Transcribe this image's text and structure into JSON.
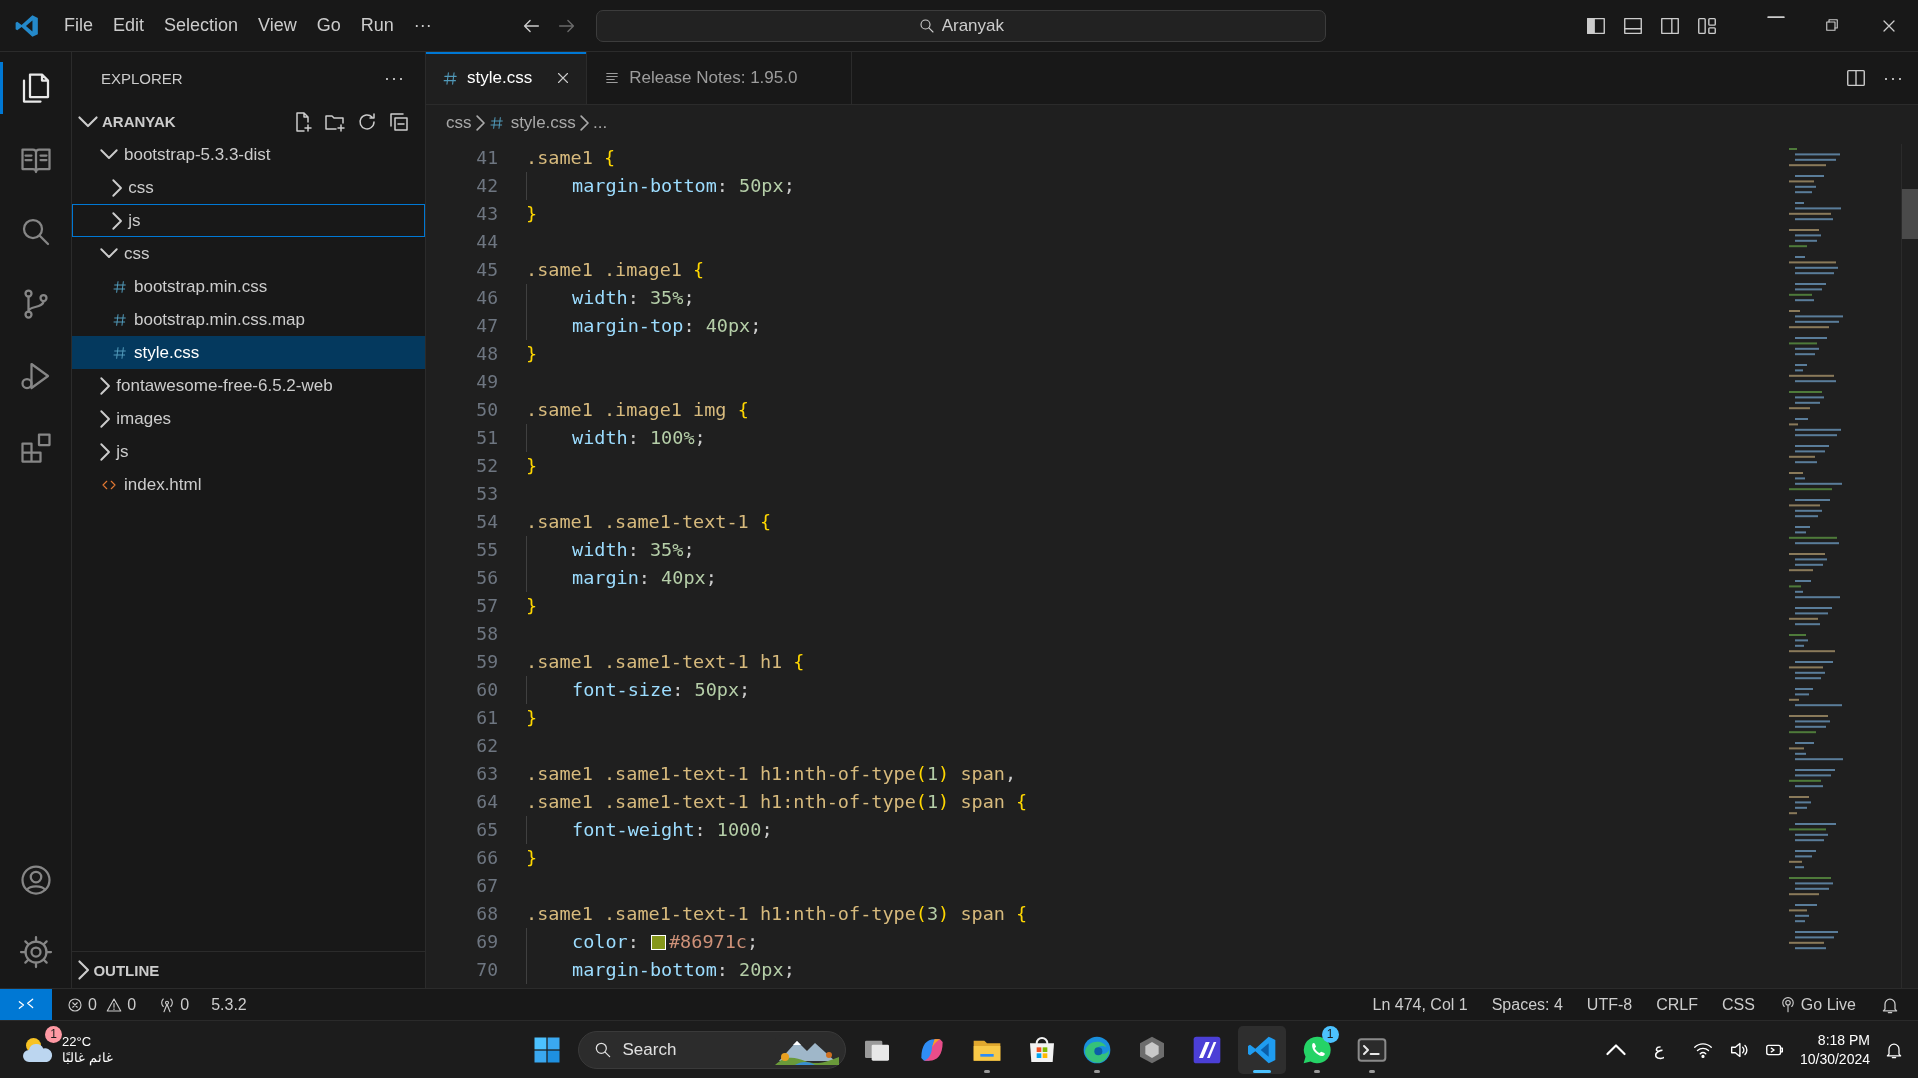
{
  "title_bar": {
    "menus": [
      "File",
      "Edit",
      "Selection",
      "View",
      "Go",
      "Run",
      "···"
    ],
    "command_center": "Aranyak"
  },
  "activity_bar": {
    "top": [
      {
        "kind": "files",
        "selected": true
      },
      {
        "kind": "book",
        "selected": false
      },
      {
        "kind": "search",
        "selected": false
      },
      {
        "kind": "branch",
        "selected": false
      },
      {
        "kind": "run",
        "selected": false
      },
      {
        "kind": "extensions",
        "selected": false
      }
    ],
    "bottom": [
      {
        "kind": "account",
        "selected": false
      },
      {
        "kind": "gear",
        "selected": false
      }
    ]
  },
  "sidebar": {
    "title": "EXPLORER",
    "more": "···",
    "root": {
      "label": "ARANYAK",
      "expanded": true
    },
    "tree": [
      {
        "label": "bootstrap-5.3.3-dist",
        "kind": "folder",
        "expanded": true,
        "selected": false,
        "focused": false,
        "children": [
          {
            "label": "css",
            "kind": "folder",
            "expanded": false,
            "selected": false,
            "focused": false
          },
          {
            "label": "js",
            "kind": "folder",
            "expanded": false,
            "selected": false,
            "focused": true
          }
        ]
      },
      {
        "label": "css",
        "kind": "folder",
        "expanded": true,
        "selected": false,
        "focused": false,
        "children": [
          {
            "label": "bootstrap.min.css",
            "kind": "css",
            "selected": false,
            "focused": false
          },
          {
            "label": "bootstrap.min.css.map",
            "kind": "css",
            "selected": false,
            "focused": false
          },
          {
            "label": "style.css",
            "kind": "css",
            "selected": true,
            "focused": false
          }
        ]
      },
      {
        "label": "fontawesome-free-6.5.2-web",
        "kind": "folder",
        "expanded": false,
        "selected": false,
        "focused": false
      },
      {
        "label": "images",
        "kind": "folder",
        "expanded": false,
        "selected": false,
        "focused": false
      },
      {
        "label": "js",
        "kind": "folder",
        "expanded": false,
        "selected": false,
        "focused": false
      },
      {
        "label": "index.html",
        "kind": "html",
        "selected": false,
        "focused": false
      }
    ],
    "outline": {
      "label": "OUTLINE",
      "expanded": false
    }
  },
  "tabs": [
    {
      "label": "style.css",
      "kind": "css",
      "selected": true
    },
    {
      "label": "Release Notes: 1.95.0",
      "kind": "notes",
      "selected": false
    }
  ],
  "editor_actions": {
    "more": "···"
  },
  "breadcrumbs": [
    {
      "label": "css",
      "kind": "folder"
    },
    {
      "label": "style.css",
      "kind": "css"
    },
    {
      "label": "...",
      "kind": "more"
    }
  ],
  "editor": {
    "lines": [
      {
        "num": "41",
        "indented": false,
        "code": ".same1 {"
      },
      {
        "num": "42",
        "indented": true,
        "code": "margin-bottom: 50px;"
      },
      {
        "num": "43",
        "indented": false,
        "code": "}"
      },
      {
        "num": "44",
        "indented": false
      },
      {
        "num": "45",
        "indented": false,
        "code": ".same1 .image1 {"
      },
      {
        "num": "46",
        "indented": true,
        "code": "width: 35%;"
      },
      {
        "num": "47",
        "indented": true,
        "code": "margin-top: 40px;"
      },
      {
        "num": "48",
        "indented": false,
        "code": "}"
      },
      {
        "num": "49",
        "indented": false
      },
      {
        "num": "50",
        "indented": false,
        "code": ".same1 .image1 img {"
      },
      {
        "num": "51",
        "indented": true,
        "code": "width: 100%;"
      },
      {
        "num": "52",
        "indented": false,
        "code": "}"
      },
      {
        "num": "53",
        "indented": false
      },
      {
        "num": "54",
        "indented": false,
        "code": ".same1 .same1-text-1 {"
      },
      {
        "num": "55",
        "indented": true,
        "code": "width: 35%;"
      },
      {
        "num": "56",
        "indented": true,
        "code": "margin: 40px;"
      },
      {
        "num": "57",
        "indented": false,
        "code": "}"
      },
      {
        "num": "58",
        "indented": false
      },
      {
        "num": "59",
        "indented": false,
        "code": ".same1 .same1-text-1 h1 {"
      },
      {
        "num": "60",
        "indented": true,
        "code": "font-size: 50px;"
      },
      {
        "num": "61",
        "indented": false,
        "code": "}"
      },
      {
        "num": "62",
        "indented": false
      },
      {
        "num": "63",
        "indented": false,
        "code": ".same1 .same1-text-1 h1:nth-of-type(1) span,"
      },
      {
        "num": "64",
        "indented": false,
        "code": ".same1 .same1-text-1 h1:nth-of-type(1) span {"
      },
      {
        "num": "65",
        "indented": true,
        "code": "font-weight: 1000;"
      },
      {
        "num": "66",
        "indented": false,
        "code": "}"
      },
      {
        "num": "67",
        "indented": false
      },
      {
        "num": "68",
        "indented": false,
        "code": ".same1 .same1-text-1 h1:nth-of-type(3) span {"
      },
      {
        "num": "69",
        "indented": true,
        "swatch": {
          "color": "#86971c"
        },
        "code": "color: #86971c;"
      },
      {
        "num": "70",
        "indented": true,
        "code": "margin-bottom: 20px;"
      }
    ]
  },
  "status_bar": {
    "errors": "0",
    "warnings": "0",
    "ports": "0",
    "version": "5.3.2",
    "right": [
      {
        "kind": "text",
        "label": "Ln 474, Col 1"
      },
      {
        "kind": "text",
        "label": "Spaces: 4"
      },
      {
        "kind": "text",
        "label": "UTF-8"
      },
      {
        "kind": "text",
        "label": "CRLF"
      },
      {
        "kind": "text",
        "label": "CSS"
      },
      {
        "kind": "golive",
        "label": "Go Live"
      },
      {
        "kind": "bell"
      }
    ]
  },
  "taskbar": {
    "weather": {
      "temperature": "22°C",
      "condition": "غائم غالبًا",
      "badge": "1"
    },
    "search": {
      "label": "Search"
    },
    "apps": [
      {
        "kind": "taskview",
        "running": false,
        "selected": false
      },
      {
        "kind": "copilot",
        "running": false,
        "selected": false
      },
      {
        "kind": "folder",
        "running": true,
        "selected": false
      },
      {
        "kind": "store",
        "running": false,
        "selected": false
      },
      {
        "kind": "edge",
        "running": true,
        "selected": false
      },
      {
        "kind": "hexagon",
        "running": false,
        "selected": false
      },
      {
        "kind": "purple",
        "running": false,
        "selected": false
      },
      {
        "kind": "vscode",
        "running": true,
        "selected": true
      },
      {
        "kind": "whatsapp",
        "running": true,
        "selected": false,
        "badge": "1"
      },
      {
        "kind": "terminal",
        "running": true,
        "selected": false
      }
    ],
    "tray": {
      "language": "ع",
      "time": "8:18 PM",
      "date": "10/30/2024"
    }
  }
}
